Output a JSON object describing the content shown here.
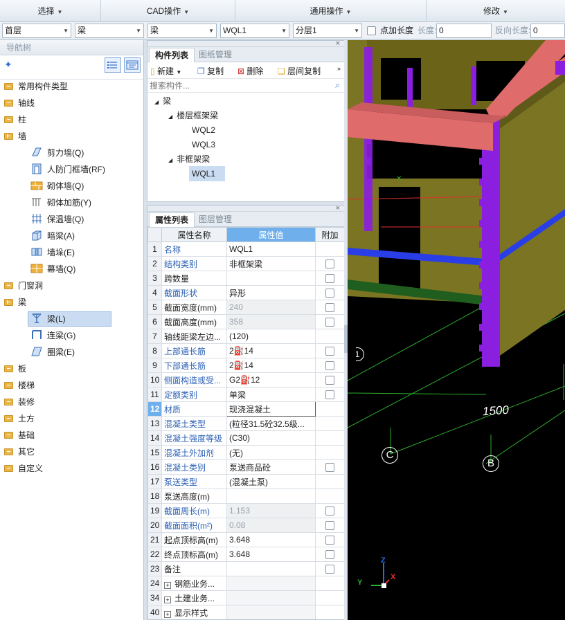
{
  "menubar": {
    "items": [
      {
        "label": "选择"
      },
      {
        "label": "CAD操作"
      },
      {
        "label": "通用操作"
      },
      {
        "label": "修改"
      }
    ]
  },
  "toolbar": {
    "floor": "首层",
    "category": "梁",
    "subcategory": "梁",
    "component": "WQL1",
    "layer": "分层1",
    "point_length_label": "点加长度",
    "length_label": "长度:",
    "length_value": "0",
    "reverse_length_label": "反向长度:",
    "reverse_length_value": "0"
  },
  "nav": {
    "title": "导航树",
    "items": [
      {
        "label": "常用构件类型"
      },
      {
        "label": "轴线"
      },
      {
        "label": "柱"
      },
      {
        "label": "墙"
      },
      {
        "label": "剪力墙(Q)"
      },
      {
        "label": "人防门框墙(RF)"
      },
      {
        "label": "砌体墙(Q)"
      },
      {
        "label": "砌体加筋(Y)"
      },
      {
        "label": "保温墙(Q)"
      },
      {
        "label": "暗梁(A)"
      },
      {
        "label": "墙垛(E)"
      },
      {
        "label": "幕墙(Q)"
      },
      {
        "label": "门窗洞"
      },
      {
        "label": "梁"
      },
      {
        "label": "梁(L)"
      },
      {
        "label": "连梁(G)"
      },
      {
        "label": "圈梁(E)"
      },
      {
        "label": "板"
      },
      {
        "label": "楼梯"
      },
      {
        "label": "装修"
      },
      {
        "label": "土方"
      },
      {
        "label": "基础"
      },
      {
        "label": "其它"
      },
      {
        "label": "自定义"
      }
    ]
  },
  "component_panel": {
    "tabs": [
      "构件列表",
      "图纸管理"
    ],
    "buttons": {
      "new": "新建",
      "copy": "复制",
      "delete": "删除",
      "floor_copy": "层间复制"
    },
    "search_placeholder": "搜索构件...",
    "tree": {
      "root": "梁",
      "group1": "楼层框架梁",
      "group1_items": [
        "WQL2",
        "WQL3"
      ],
      "group2": "非框架梁",
      "group2_items": [
        "WQL1"
      ]
    }
  },
  "property_panel": {
    "tabs": [
      "属性列表",
      "图层管理"
    ],
    "columns": [
      "属性名称",
      "属性值",
      "附加"
    ],
    "rows": [
      {
        "n": "1",
        "name": "名称",
        "value": "WQL1"
      },
      {
        "n": "2",
        "name": "结构类别",
        "value": "非框架梁"
      },
      {
        "n": "3",
        "name": "跨数量",
        "value": ""
      },
      {
        "n": "4",
        "name": "截面形状",
        "value": "异形"
      },
      {
        "n": "5",
        "name": "截面宽度(mm)",
        "value": "240"
      },
      {
        "n": "6",
        "name": "截面高度(mm)",
        "value": "358"
      },
      {
        "n": "7",
        "name": "轴线距梁左边...",
        "value": "(120)"
      },
      {
        "n": "8",
        "name": "上部通长筋",
        "value": "2⛽14"
      },
      {
        "n": "9",
        "name": "下部通长筋",
        "value": "2⛽14"
      },
      {
        "n": "10",
        "name": "侧面构造或受...",
        "value": "G2⛽12"
      },
      {
        "n": "11",
        "name": "定额类别",
        "value": "单梁"
      },
      {
        "n": "12",
        "name": "材质",
        "value": "现浇混凝土"
      },
      {
        "n": "13",
        "name": "混凝土类型",
        "value": "(粒径31.5砼32.5级..."
      },
      {
        "n": "14",
        "name": "混凝土强度等级",
        "value": "(C30)"
      },
      {
        "n": "15",
        "name": "混凝土外加剂",
        "value": "(无)"
      },
      {
        "n": "16",
        "name": "混凝土类别",
        "value": "泵送商品砼"
      },
      {
        "n": "17",
        "name": "泵送类型",
        "value": "(混凝土泵)"
      },
      {
        "n": "18",
        "name": "泵送高度(m)",
        "value": ""
      },
      {
        "n": "19",
        "name": "截面周长(m)",
        "value": "1.153"
      },
      {
        "n": "20",
        "name": "截面面积(m²)",
        "value": "0.08"
      },
      {
        "n": "21",
        "name": "起点顶标高(m)",
        "value": "3.648"
      },
      {
        "n": "22",
        "name": "终点顶标高(m)",
        "value": "3.648"
      },
      {
        "n": "23",
        "name": "备注",
        "value": ""
      },
      {
        "n": "24",
        "name": "钢筋业务...",
        "value": ""
      },
      {
        "n": "34",
        "name": "土建业务...",
        "value": ""
      },
      {
        "n": "40",
        "name": "显示样式",
        "value": ""
      }
    ]
  },
  "viewport": {
    "dimension_label": "1500",
    "axis_c": "C",
    "axis_b": "B",
    "axis_1": "1",
    "axis_x": "X",
    "axis_y": "Y",
    "axis_z": "Z"
  },
  "colors": {
    "wall": "#7b7422",
    "beam": "#e06b6b",
    "column": "#8a1fe0",
    "rebar_blue": "#2a3ee8",
    "grid_green": "#2fae2f"
  }
}
